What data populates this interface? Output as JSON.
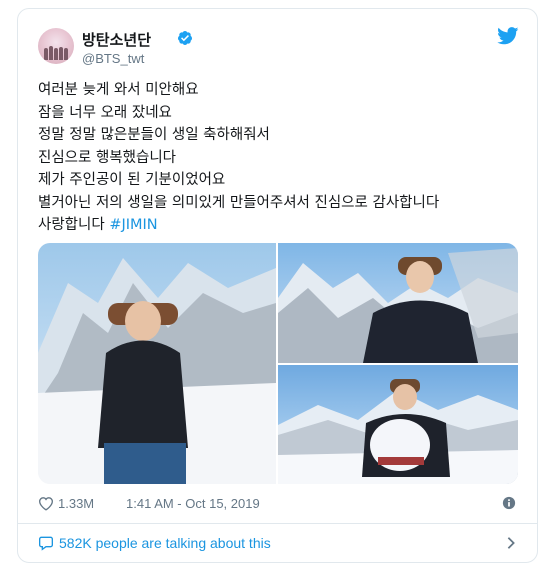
{
  "tweet": {
    "author": {
      "display_name": "방탄소년단",
      "handle": "@BTS_twt",
      "verified": true
    },
    "lines": [
      "여러분 늦게 와서 미안해요",
      "잠을 너무 오래 잤네요",
      "정말 정말 많은분들이 생일 축하해줘서",
      "진심으로 행복했습니다",
      "제가 주인공이 된 기분이었어요",
      "별거아닌 저의 생일을 의미있게 만들어주셔서 진심으로 감사합니다",
      "사랑합니다"
    ],
    "hashtag": "#JIMIN",
    "photo_count": 3,
    "likes": "1.33M",
    "timestamp": "1:41 AM - Oct 15, 2019",
    "talking_about": "582K people are talking about this"
  },
  "icons": {
    "brand": "twitter-bird-icon",
    "verified": "verified-badge-icon",
    "like": "heart-icon",
    "info": "info-icon",
    "conversation": "speech-bubble-icon",
    "more": "chevron-right-icon"
  },
  "colors": {
    "brand_blue": "#1da1f2",
    "link_blue": "#1b95e0",
    "text": "#14171a",
    "muted": "#657786",
    "border": "#e1e8ed"
  }
}
